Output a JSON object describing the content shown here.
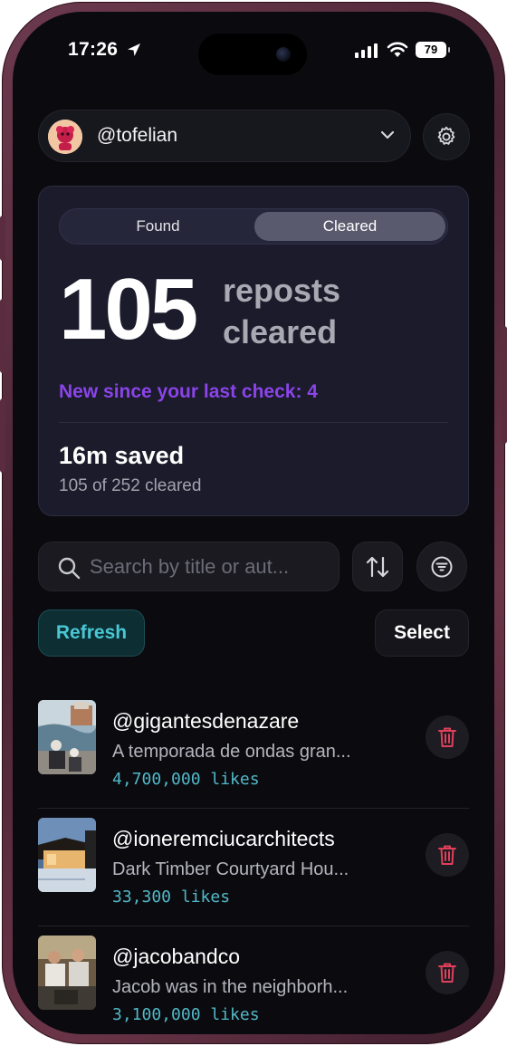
{
  "status_bar": {
    "time": "17:26",
    "battery": "79"
  },
  "account": {
    "handle": "@tofelian"
  },
  "stats": {
    "tabs": [
      {
        "label": "Found",
        "selected": false
      },
      {
        "label": "Cleared",
        "selected": true
      }
    ],
    "count": "105",
    "count_label_line1": "reposts",
    "count_label_line2": "cleared",
    "new_since": "New since your last check: 4",
    "saved": "16m saved",
    "progress": "105 of 252 cleared"
  },
  "search": {
    "placeholder": "Search by title or aut..."
  },
  "actions": {
    "refresh": "Refresh",
    "select": "Select"
  },
  "reposts": [
    {
      "handle": "@gigantesdenazare",
      "title": "A temporada de ondas gran...",
      "likes": "4,700,000 likes"
    },
    {
      "handle": "@ioneremciucarchitects",
      "title": "Dark Timber Courtyard Hou...",
      "likes": "33,300 likes"
    },
    {
      "handle": "@jacobandco",
      "title": "Jacob was in the neighborh...",
      "likes": "3,100,000 likes"
    }
  ],
  "colors": {
    "accent_purple": "#8a44e8",
    "accent_teal": "#49c7d4",
    "delete_red": "#e0405a",
    "frame": "#5a2c3d"
  },
  "icons": [
    "location-arrow-icon",
    "cellular-signal-icon",
    "wifi-icon",
    "battery-icon",
    "chevron-down-icon",
    "gear-icon",
    "search-icon",
    "sort-icon",
    "filter-icon",
    "trash-icon"
  ]
}
